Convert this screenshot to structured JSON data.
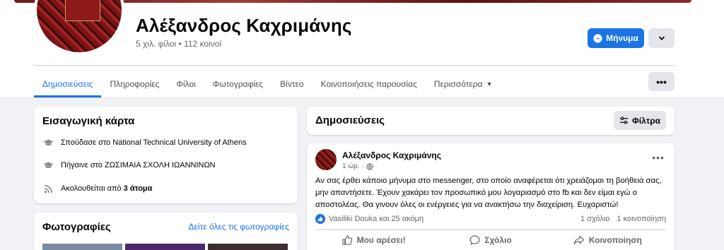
{
  "profile": {
    "name": "Αλέξανδρος Καχριμάνης",
    "meta": "5 χιλ. φίλοι • 112 κοινοί"
  },
  "header_buttons": {
    "message_label": "Μήνυμα"
  },
  "tabs": [
    {
      "label": "Δημοσιεύσεις",
      "active": true
    },
    {
      "label": "Πληροφορίες",
      "active": false
    },
    {
      "label": "Φίλοι",
      "active": false
    },
    {
      "label": "Φωτογραφίες",
      "active": false
    },
    {
      "label": "Βίντεο",
      "active": false
    },
    {
      "label": "Κοινοποιήσεις παρουσίας",
      "active": false
    },
    {
      "label": "Περισσότερα",
      "active": false
    }
  ],
  "intro": {
    "title": "Εισαγωγική κάρτα",
    "studied": "Σπούδασε στο National Technical University of Athens",
    "went_to": "Πήγαινε στο ΖΩΣΙΜΑΙΑ ΣΧΟΛΗ ΙΩΑΝΝΙΝΩΝ",
    "followed_prefix": "Ακολουθείται από",
    "followed_count": "3 άτομα"
  },
  "photos": {
    "title": "Φωτογραφίες",
    "see_all": "Δείτε όλες τις φωτογραφίες"
  },
  "posts_header": {
    "title": "Δημοσιεύσεις",
    "filter_label": "Φίλτρα"
  },
  "post": {
    "author": "Αλέξανδρος Καχριμάνης",
    "time": "1 ώρ.",
    "text": "Αν σας έρθει κάποιο μήνυμα  στο messenger, στο οποίο αναφέρεται ότι χρειάζομαι τη βοήθειά σας, μην απαντήσετε. Έχουν χακάρει τον προσωπικό μου λογαριασμό στο fb και δεν είμαι εγώ ο αποστολέας. Θα γινουν όλες οι ενέργειες για να ανακτήσω την διαχείριση.  Ευχαριστώ!",
    "reactions": "Vasiliki Douka και 25 ακόμη",
    "comments": "1 σχόλιο",
    "shares": "1 κοινοποίηση",
    "like_label": "Μου αρέσει!",
    "comment_label": "Σχόλιο",
    "share_label": "Κοινοποίηση"
  },
  "colors": {
    "accent": "#1b74e4",
    "background": "#f0f2f5",
    "secondary_text": "#65676b"
  }
}
